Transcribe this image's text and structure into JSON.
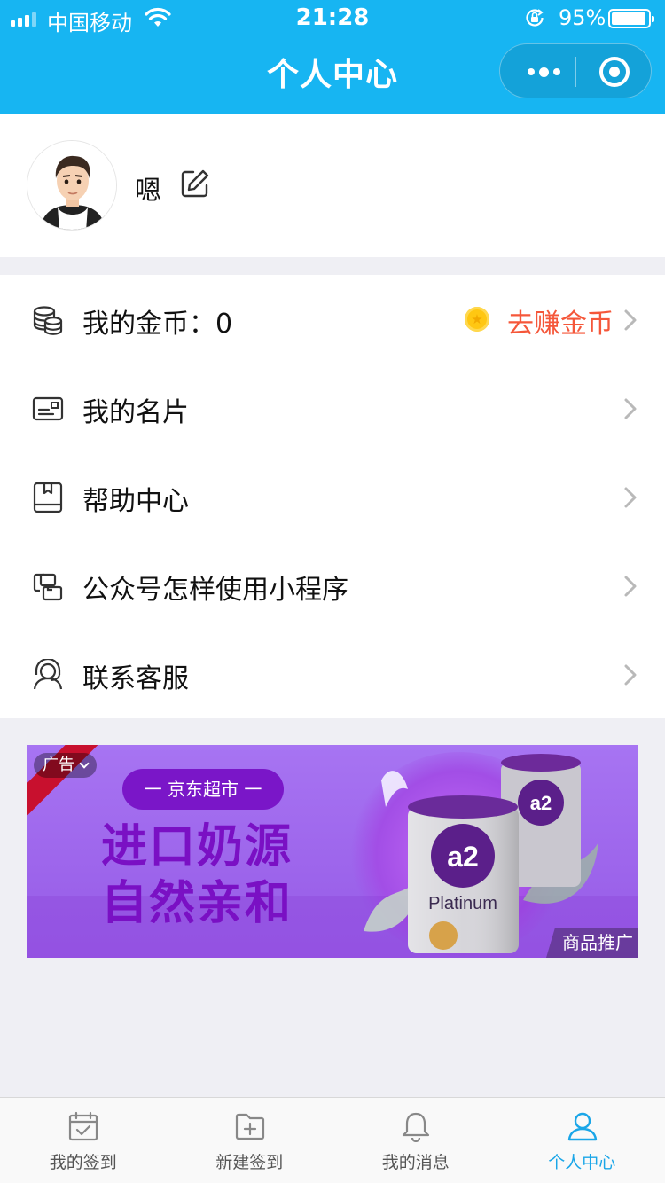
{
  "status_bar": {
    "carrier": "中国移动",
    "time": "21:28",
    "battery_text": "95%",
    "battery_level": 0.95
  },
  "nav": {
    "title": "个人中心",
    "more_icon": "more-dots-icon",
    "close_icon": "target-icon"
  },
  "profile": {
    "username": "嗯",
    "edit_icon": "edit-icon"
  },
  "menu": {
    "items": [
      {
        "label": "我的金币：0",
        "icon": "coins-icon",
        "action_label": "去赚金币",
        "action_color": "#f5573a"
      },
      {
        "label": "我的名片",
        "icon": "card-icon"
      },
      {
        "label": "帮助中心",
        "icon": "book-icon"
      },
      {
        "label": "公众号怎样使用小程序",
        "icon": "link-icon"
      },
      {
        "label": "联系客服",
        "icon": "headset-icon"
      }
    ]
  },
  "ad": {
    "label": "广告",
    "tag": "一 京东超市 一",
    "headline": "进口奶源",
    "subline": "自然亲和",
    "promo": "商品推广",
    "product_text": "a2",
    "product_name": "Platinum"
  },
  "tabbar": {
    "tabs": [
      {
        "label": "我的签到",
        "icon": "calendar-check-icon",
        "active": false
      },
      {
        "label": "新建签到",
        "icon": "folder-add-icon",
        "active": false
      },
      {
        "label": "我的消息",
        "icon": "bell-icon",
        "active": false
      },
      {
        "label": "个人中心",
        "icon": "user-icon",
        "active": true
      }
    ]
  },
  "colors": {
    "header": "#17b5f2",
    "accent": "#1aa6e8",
    "earn": "#f5573a",
    "coin": "#ffc712",
    "ad_purple": "#7a10c4"
  }
}
